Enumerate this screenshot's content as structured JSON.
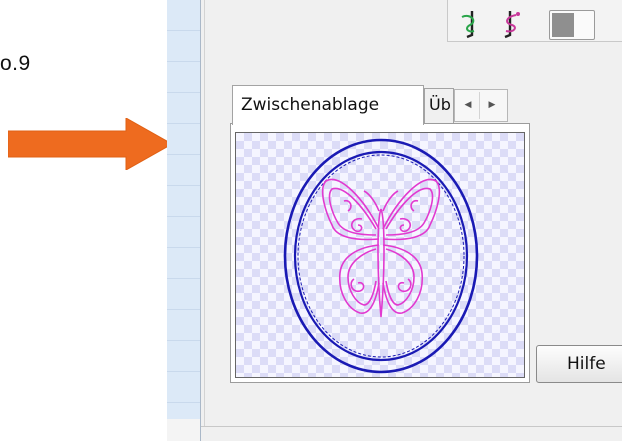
{
  "step_label": "o.9",
  "arrow": {
    "color": "#ee6b1f"
  },
  "tabs": {
    "active": "Zwischenablage",
    "inactive": "Üb",
    "scroll_left_icon": "◀",
    "scroll_right_icon": "▶"
  },
  "preview": {
    "frame_color": "#1a1ab4",
    "design_color": "#e23ad0",
    "background": "checkerboard-lavender"
  },
  "buttons": {
    "help": "Hilfe"
  },
  "toolbar": {
    "icons": [
      "needle-thread-green-icon",
      "needle-thread-pink-icon",
      "toggle-view-icon"
    ]
  }
}
